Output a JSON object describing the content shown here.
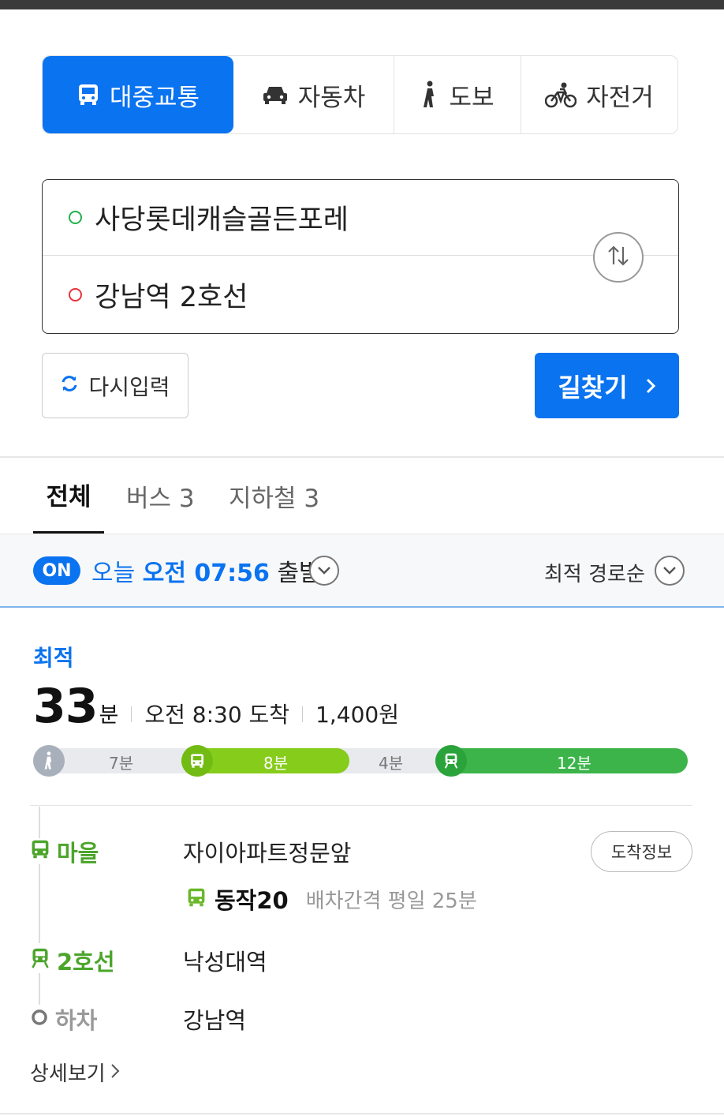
{
  "modes": {
    "transit": "대중교통",
    "car": "자동차",
    "walk": "도보",
    "bike": "자전거"
  },
  "route": {
    "origin": "사당롯데캐슬골든포레",
    "destination": "강남역 2호선"
  },
  "buttons": {
    "reset": "다시입력",
    "search": "길찾기"
  },
  "filter_tabs": {
    "all": "전체",
    "bus": "버스 3",
    "subway": "지하철 3"
  },
  "options": {
    "on_badge": "ON",
    "day": "오늘",
    "time": "오전 07:56",
    "depart": "출발",
    "sort": "최적 경로순"
  },
  "result": {
    "best_label": "최적",
    "duration_value": "33",
    "duration_unit": "분",
    "arrival": "오전 8:30 도착",
    "fare": "1,400원",
    "timeline": {
      "walk1": "7분",
      "bus": "8분",
      "walk2": "4분",
      "subway": "12분"
    },
    "steps": [
      {
        "type": "마을",
        "stop": "자이아파트정문앞"
      },
      {
        "type": "2호선",
        "stop": "낙성대역"
      },
      {
        "type": "하차",
        "stop": "강남역"
      }
    ],
    "arrival_info": "도착정보",
    "bus_number": "동작20",
    "bus_interval": "배차간격 평일 25분",
    "detail": "상세보기"
  },
  "colors": {
    "primary": "#0a73f0",
    "bus_green": "#86cc1b",
    "subway_green": "#3cb44a",
    "origin_dot": "#22b14c",
    "destination_dot": "#e8333a"
  }
}
